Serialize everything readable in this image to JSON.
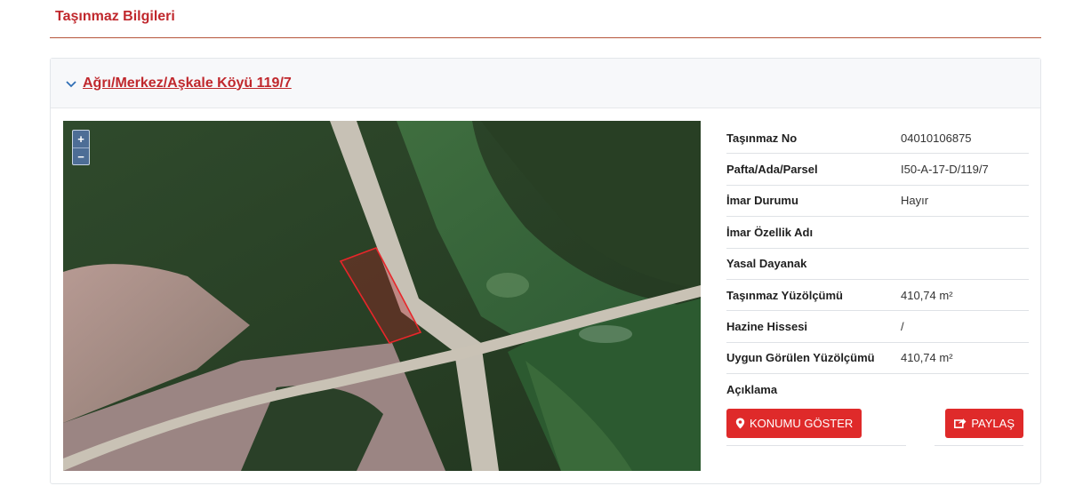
{
  "section": {
    "title": "Taşınmaz Bilgileri"
  },
  "card": {
    "link": "Ağrı/Merkez/Aşkale Köyü 119/7"
  },
  "map": {
    "zoom_in": "+",
    "zoom_out": "−"
  },
  "info": [
    {
      "label": "Taşınmaz No",
      "value": "04010106875"
    },
    {
      "label": "Pafta/Ada/Parsel",
      "value": "I50-A-17-D/119/7"
    },
    {
      "label": "İmar Durumu",
      "value": "Hayır"
    },
    {
      "label": "İmar Özellik Adı",
      "value": ""
    },
    {
      "label": "Yasal Dayanak",
      "value": ""
    },
    {
      "label": "Taşınmaz Yüzölçümü",
      "value": "410,74 m²"
    },
    {
      "label": "Hazine Hissesi",
      "value": "/"
    },
    {
      "label": "Uygun Görülen Yüzölçümü",
      "value": "410,74 m²"
    },
    {
      "label": "Açıklama",
      "value": ""
    }
  ],
  "actions": {
    "show_location": "KONUMU GÖSTER",
    "share": "PAYLAŞ"
  },
  "colors": {
    "accent": "#c0282d",
    "button": "#df2a2a",
    "parcel": "#e8262a"
  }
}
